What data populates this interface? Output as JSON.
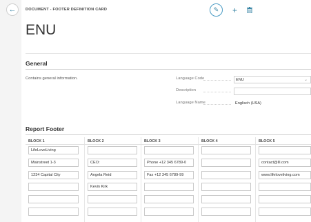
{
  "header": {
    "label": "DOCUMENT - FOOTER DEFINITION CARD",
    "title": "ENU"
  },
  "toolbar": {
    "edit_icon": "✎",
    "new_icon": "+",
    "delete_icon": "🗑",
    "accent": "#3a86a6"
  },
  "general": {
    "title": "General",
    "info": "Contains general information.",
    "fields": {
      "language_code": {
        "label": "Language Code",
        "value": "ENU"
      },
      "description": {
        "label": "Description",
        "value": ""
      },
      "language_name": {
        "label": "Language Name",
        "value": "Englisch (USA)"
      }
    }
  },
  "report_footer": {
    "title": "Report Footer",
    "columns": [
      "BLOCK 1",
      "BLOCK 2",
      "BLOCK 3",
      "BLOCK 4",
      "BLOCK 5"
    ],
    "rows": [
      [
        "LifeLoveLiving",
        "",
        "",
        "",
        ""
      ],
      [
        "Mainstreet 1-3",
        "CEO:",
        "Phone +12 345 6789-0",
        "",
        "contact@lll.com"
      ],
      [
        "1234 Capital City",
        "Angela Reid",
        "Fax +12 345 6789-99",
        "",
        "www.lifeloveliving.com"
      ],
      [
        "",
        "Kevin Kirk",
        "",
        "",
        ""
      ],
      [
        "",
        "",
        "",
        "",
        ""
      ],
      [
        "",
        "",
        "",
        "",
        ""
      ]
    ]
  }
}
